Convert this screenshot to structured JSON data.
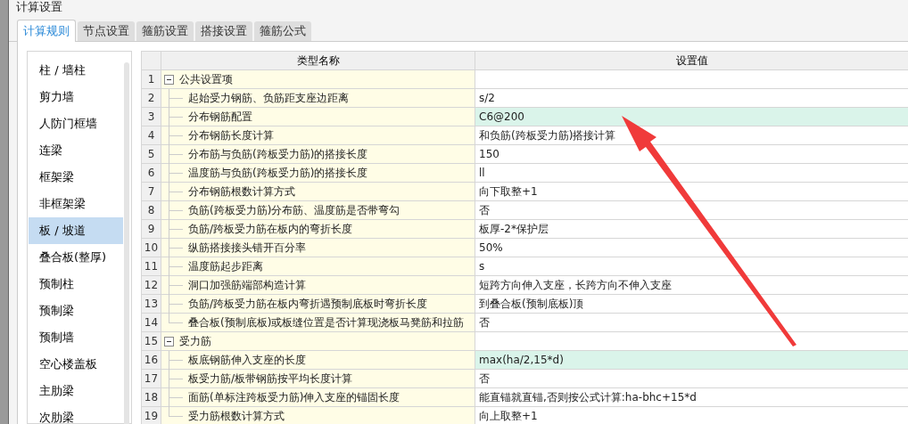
{
  "window": {
    "title": "计算设置"
  },
  "tabs": [
    {
      "label": "计算规则",
      "selected": true
    },
    {
      "label": "节点设置",
      "selected": false
    },
    {
      "label": "箍筋设置",
      "selected": false
    },
    {
      "label": "搭接设置",
      "selected": false
    },
    {
      "label": "箍筋公式",
      "selected": false
    }
  ],
  "sidebar": {
    "items": [
      {
        "label": "柱 / 墙柱",
        "selected": false
      },
      {
        "label": "剪力墙",
        "selected": false
      },
      {
        "label": "人防门框墙",
        "selected": false
      },
      {
        "label": "连梁",
        "selected": false
      },
      {
        "label": "框架梁",
        "selected": false
      },
      {
        "label": "非框架梁",
        "selected": false
      },
      {
        "label": "板 / 坡道",
        "selected": true
      },
      {
        "label": "叠合板(整厚)",
        "selected": false
      },
      {
        "label": "预制柱",
        "selected": false
      },
      {
        "label": "预制梁",
        "selected": false
      },
      {
        "label": "预制墙",
        "selected": false
      },
      {
        "label": "空心楼盖板",
        "selected": false
      },
      {
        "label": "主肋梁",
        "selected": false
      },
      {
        "label": "次肋梁",
        "selected": false
      }
    ]
  },
  "table": {
    "columns": [
      "类型名称",
      "设置值"
    ],
    "groups": [
      {
        "number": "1",
        "label": "公共设置项",
        "expanded": true,
        "children": [
          {
            "number": "2",
            "label": "起始受力钢筋、负筋距支座边距离",
            "value": "s/2",
            "highlighted": false
          },
          {
            "number": "3",
            "label": "分布钢筋配置",
            "value": "C6@200",
            "highlighted": true
          },
          {
            "number": "4",
            "label": "分布钢筋长度计算",
            "value": "和负筋(跨板受力筋)搭接计算",
            "highlighted": false
          },
          {
            "number": "5",
            "label": "分布筋与负筋(跨板受力筋)的搭接长度",
            "value": "150",
            "highlighted": false
          },
          {
            "number": "6",
            "label": "温度筋与负筋(跨板受力筋)的搭接长度",
            "value": "ll",
            "highlighted": false
          },
          {
            "number": "7",
            "label": "分布钢筋根数计算方式",
            "value": "向下取整+1",
            "highlighted": false
          },
          {
            "number": "8",
            "label": "负筋(跨板受力筋)分布筋、温度筋是否带弯勾",
            "value": "否",
            "highlighted": false
          },
          {
            "number": "9",
            "label": "负筋/跨板受力筋在板内的弯折长度",
            "value": "板厚-2*保护层",
            "highlighted": false
          },
          {
            "number": "10",
            "label": "纵筋搭接接头错开百分率",
            "value": "50%",
            "highlighted": false
          },
          {
            "number": "11",
            "label": "温度筋起步距离",
            "value": "s",
            "highlighted": false
          },
          {
            "number": "12",
            "label": "洞口加强筋端部构造计算",
            "value": "短跨方向伸入支座，长跨方向不伸入支座",
            "highlighted": false
          },
          {
            "number": "13",
            "label": "负筋/跨板受力筋在板内弯折遇预制底板时弯折长度",
            "value": "到叠合板(预制底板)顶",
            "highlighted": false
          },
          {
            "number": "14",
            "label": "叠合板(预制底板)或板缝位置是否计算现浇板马凳筋和拉筋",
            "value": "否",
            "highlighted": false
          }
        ]
      },
      {
        "number": "15",
        "label": "受力筋",
        "expanded": true,
        "children": [
          {
            "number": "16",
            "label": "板底钢筋伸入支座的长度",
            "value": "max(ha/2,15*d)",
            "highlighted": true
          },
          {
            "number": "17",
            "label": "板受力筋/板带钢筋按平均长度计算",
            "value": "否",
            "highlighted": false
          },
          {
            "number": "18",
            "label": "面筋(单标注跨板受力筋)伸入支座的锚固长度",
            "value": "能直锚就直锚,否则按公式计算:ha-bhc+15*d",
            "highlighted": false
          },
          {
            "number": "19",
            "label": "受力筋根数计算方式",
            "value": "向上取整+1",
            "highlighted": false
          }
        ]
      }
    ]
  }
}
